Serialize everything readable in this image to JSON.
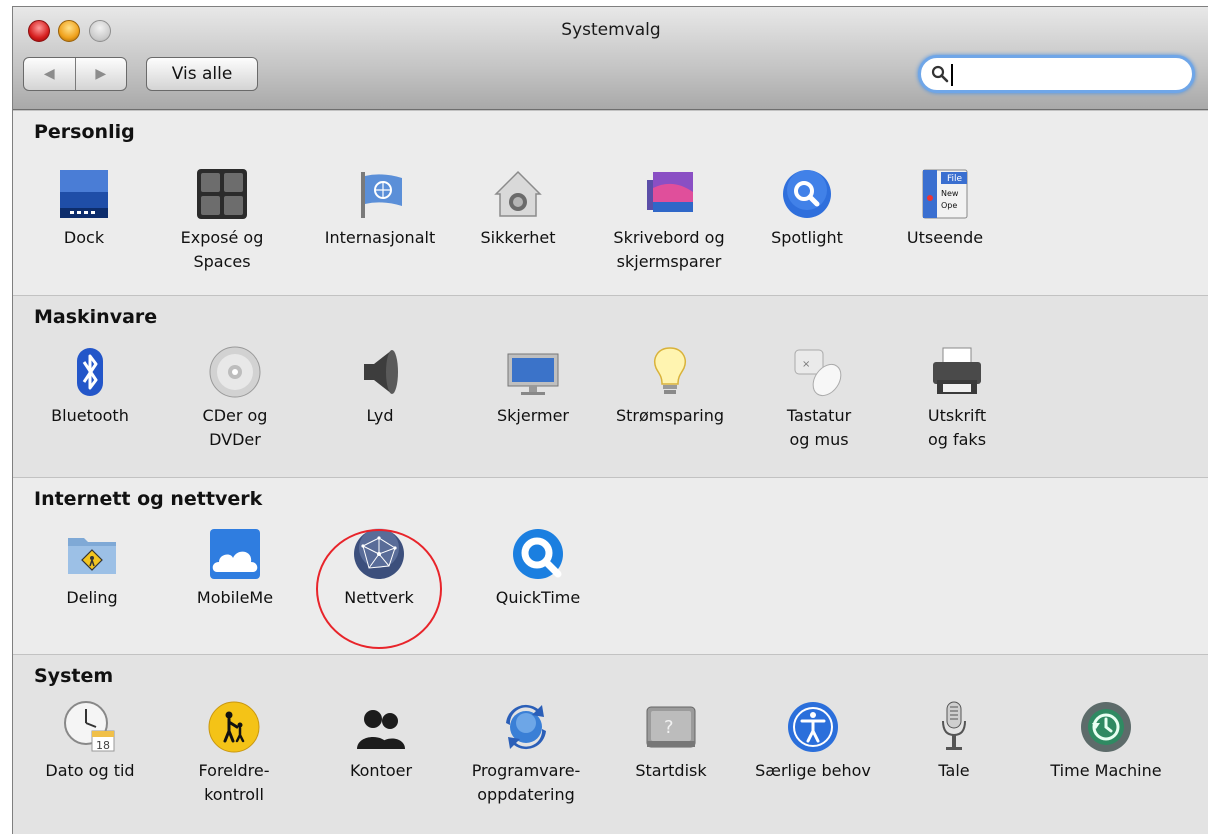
{
  "window": {
    "title": "Systemvalg"
  },
  "toolbar": {
    "back_symbol": "◀",
    "forward_symbol": "▶",
    "show_all_label": "Vis alle",
    "search_value": ""
  },
  "sections": {
    "personal": {
      "title": "Personlig",
      "items": [
        "Dock",
        "Exposé og\nSpaces",
        "Internasjonalt",
        "Sikkerhet",
        "Skrivebord og\nskjermsparer",
        "Spotlight",
        "Utseende"
      ]
    },
    "hardware": {
      "title": "Maskinvare",
      "items": [
        "Bluetooth",
        "CDer og\nDVDer",
        "Lyd",
        "Skjermer",
        "Strømsparing",
        "Tastatur\nog mus",
        "Utskrift\nog faks"
      ]
    },
    "internet": {
      "title": "Internett og nettverk",
      "items": [
        "Deling",
        "MobileMe",
        "Nettverk",
        "QuickTime"
      ]
    },
    "system": {
      "title": "System",
      "items": [
        "Dato og tid",
        "Foreldre-\nkontroll",
        "Kontoer",
        "Programvare-\noppdatering",
        "Startdisk",
        "Særlige behov",
        "Tale",
        "Time Machine"
      ]
    }
  },
  "icon_texts": {
    "utseende_file": "File",
    "utseende_new": "New",
    "utseende_open": "Ope",
    "calendar_day": "18"
  },
  "colors": {
    "accent": "#3a7cde",
    "highlight_ring": "#e8242a"
  }
}
